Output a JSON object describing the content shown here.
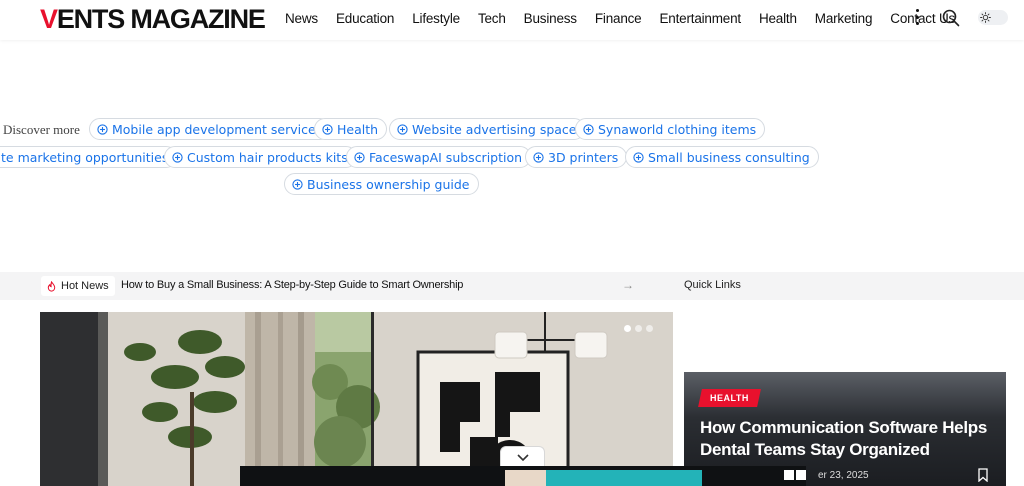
{
  "brand": {
    "logo_first": "V",
    "logo_rest": "ENTS MAGAZINE",
    "accent": "#e8112d"
  },
  "nav": {
    "items": [
      "News",
      "Education",
      "Lifestyle",
      "Tech",
      "Business",
      "Finance",
      "Entertainment",
      "Health",
      "Marketing",
      "Contact Us"
    ],
    "icons": {
      "more": "vertical-dots-icon",
      "search": "search-icon",
      "theme": "sun-icon"
    }
  },
  "discover": {
    "label": "Discover more",
    "chips": [
      "Mobile app development services",
      "Health",
      "Website advertising space",
      "Synaworld clothing items",
      "te marketing opportunities",
      "Custom hair products kits",
      "FaceswapAI subscription",
      "3D printers",
      "Small business consulting",
      "Business ownership guide"
    ],
    "chip_color": "#1a73e8"
  },
  "hot_news": {
    "badge": "Hot News",
    "headline": "How to Buy a Small Business: A Step-by-Step Guide to Smart Ownership",
    "quick_links": "Quick Links"
  },
  "featured": {
    "category": "HEALTH",
    "title": "How Communication Software Helps Dental Teams Stay Organized",
    "date": "er 23, 2025",
    "slides": 3,
    "active_slide": 1
  }
}
